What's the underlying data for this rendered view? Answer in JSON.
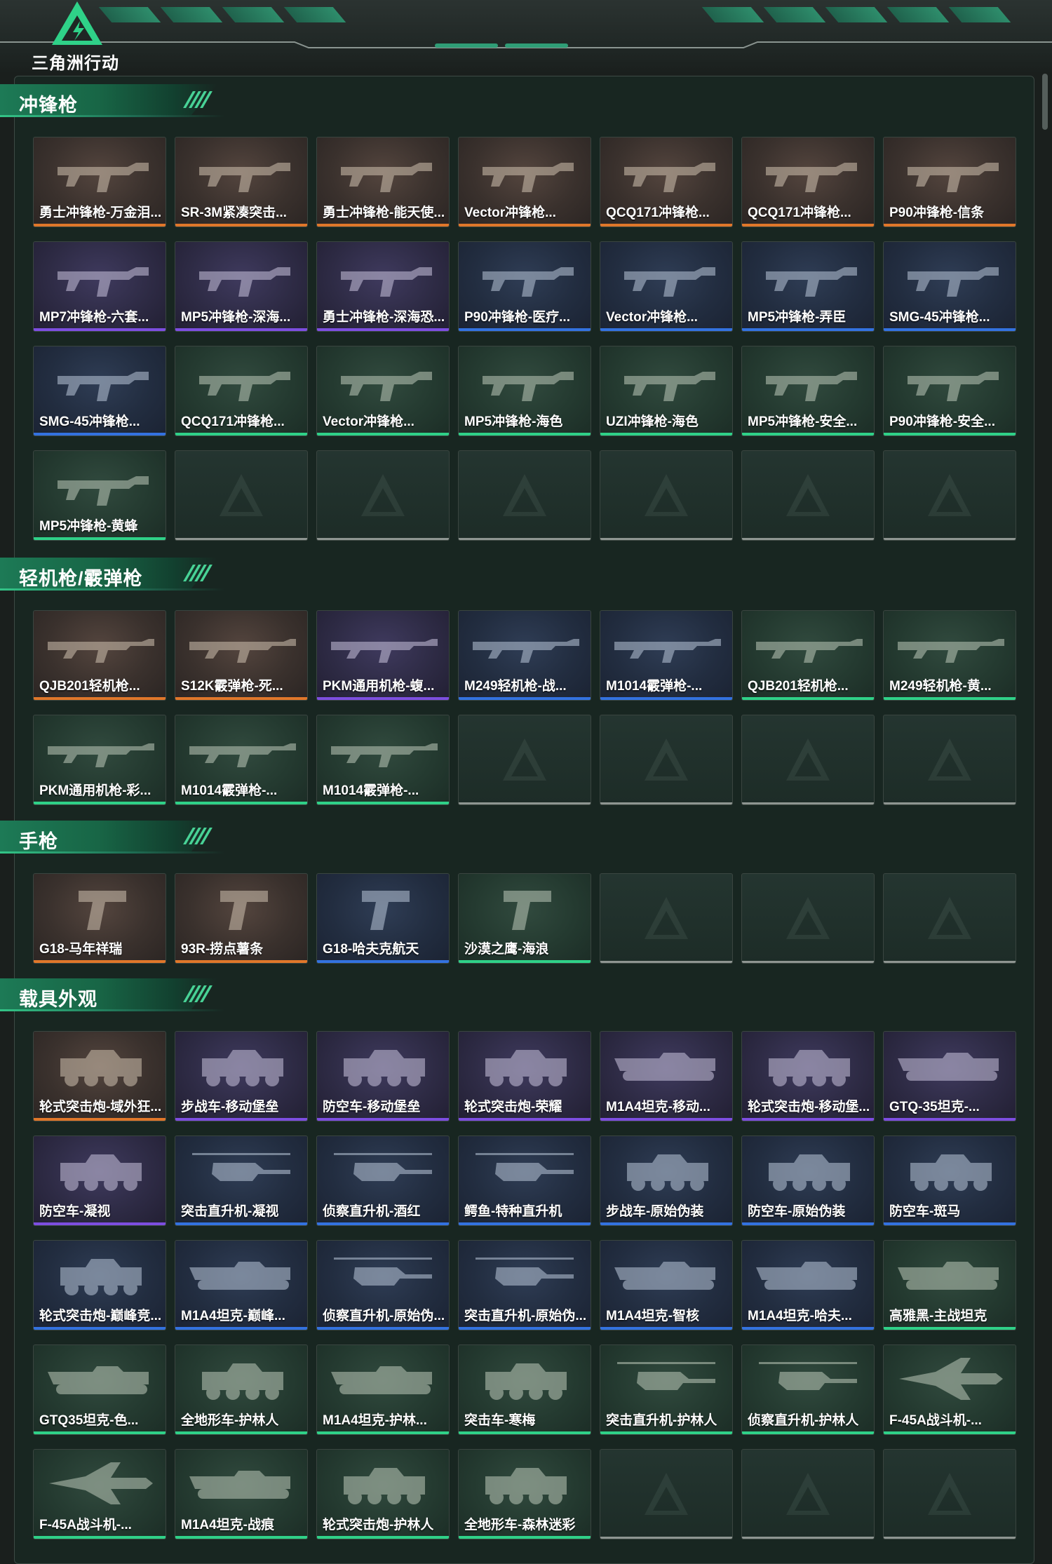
{
  "app": {
    "logo_text": "三角洲行动"
  },
  "colors": {
    "orange": "#e0772a",
    "purple": "#7d4ee0",
    "blue": "#3372e0",
    "green": "#2fd188",
    "accent": "#2f9d76"
  },
  "sections": [
    {
      "title": "冲锋枪",
      "items": [
        {
          "name": "勇士冲锋枪-万金泪...",
          "rarity": "orange",
          "art": "smg"
        },
        {
          "name": "SR-3M紧凑突击...",
          "rarity": "orange",
          "art": "smg"
        },
        {
          "name": "勇士冲锋枪-能天使...",
          "rarity": "orange",
          "art": "smg"
        },
        {
          "name": "Vector冲锋枪...",
          "rarity": "orange",
          "art": "smg"
        },
        {
          "name": "QCQ171冲锋枪...",
          "rarity": "orange",
          "art": "smg"
        },
        {
          "name": "QCQ171冲锋枪...",
          "rarity": "orange",
          "art": "smg"
        },
        {
          "name": "P90冲锋枪-信条",
          "rarity": "orange",
          "art": "smg"
        },
        {
          "name": "MP7冲锋枪-六套...",
          "rarity": "purple",
          "art": "smg"
        },
        {
          "name": "MP5冲锋枪-深海...",
          "rarity": "purple",
          "art": "smg"
        },
        {
          "name": "勇士冲锋枪-深海恐...",
          "rarity": "purple",
          "art": "smg"
        },
        {
          "name": "P90冲锋枪-医疗...",
          "rarity": "blue",
          "art": "smg"
        },
        {
          "name": "Vector冲锋枪...",
          "rarity": "blue",
          "art": "smg"
        },
        {
          "name": "MP5冲锋枪-弄臣",
          "rarity": "blue",
          "art": "smg"
        },
        {
          "name": "SMG-45冲锋枪...",
          "rarity": "blue",
          "art": "smg"
        },
        {
          "name": "SMG-45冲锋枪...",
          "rarity": "blue",
          "art": "smg"
        },
        {
          "name": "QCQ171冲锋枪...",
          "rarity": "green",
          "art": "smg"
        },
        {
          "name": "Vector冲锋枪...",
          "rarity": "green",
          "art": "smg"
        },
        {
          "name": "MP5冲锋枪-海色",
          "rarity": "green",
          "art": "smg"
        },
        {
          "name": "UZI冲锋枪-海色",
          "rarity": "green",
          "art": "smg"
        },
        {
          "name": "MP5冲锋枪-安全...",
          "rarity": "green",
          "art": "smg"
        },
        {
          "name": "P90冲锋枪-安全...",
          "rarity": "green",
          "art": "smg"
        },
        {
          "name": "MP5冲锋枪-黄蜂",
          "rarity": "green",
          "art": "smg"
        }
      ]
    },
    {
      "title": "轻机枪/霰弹枪",
      "items": [
        {
          "name": "QJB201轻机枪...",
          "rarity": "orange",
          "art": "lmg"
        },
        {
          "name": "S12K霰弹枪-死...",
          "rarity": "orange",
          "art": "lmg"
        },
        {
          "name": "PKM通用机枪-蝮...",
          "rarity": "purple",
          "art": "lmg"
        },
        {
          "name": "M249轻机枪-战...",
          "rarity": "blue",
          "art": "lmg"
        },
        {
          "name": "M1014霰弹枪-...",
          "rarity": "blue",
          "art": "lmg"
        },
        {
          "name": "QJB201轻机枪...",
          "rarity": "green",
          "art": "lmg"
        },
        {
          "name": "M249轻机枪-黄...",
          "rarity": "green",
          "art": "lmg"
        },
        {
          "name": "PKM通用机枪-彩...",
          "rarity": "green",
          "art": "lmg"
        },
        {
          "name": "M1014霰弹枪-...",
          "rarity": "green",
          "art": "lmg"
        },
        {
          "name": "M1014霰弹枪-...",
          "rarity": "green",
          "art": "lmg"
        }
      ]
    },
    {
      "title": "手枪",
      "items": [
        {
          "name": "G18-马年祥瑞",
          "rarity": "orange",
          "art": "pistol"
        },
        {
          "name": "93R-捞点薯条",
          "rarity": "orange",
          "art": "pistol"
        },
        {
          "name": "G18-哈夫克航天",
          "rarity": "blue",
          "art": "pistol"
        },
        {
          "name": "沙漠之鹰-海浪",
          "rarity": "green",
          "art": "pistol"
        }
      ]
    },
    {
      "title": "载具外观",
      "items": [
        {
          "name": "轮式突击炮-域外狂...",
          "rarity": "orange",
          "art": "vehicle"
        },
        {
          "name": "步战车-移动堡垒",
          "rarity": "purple",
          "art": "vehicle"
        },
        {
          "name": "防空车-移动堡垒",
          "rarity": "purple",
          "art": "vehicle"
        },
        {
          "name": "轮式突击炮-荣耀",
          "rarity": "purple",
          "art": "vehicle"
        },
        {
          "name": "M1A4坦克-移动...",
          "rarity": "purple",
          "art": "tank"
        },
        {
          "name": "轮式突击炮-移动堡...",
          "rarity": "purple",
          "art": "vehicle"
        },
        {
          "name": "GTQ-35坦克-...",
          "rarity": "purple",
          "art": "tank"
        },
        {
          "name": "防空车-凝视",
          "rarity": "purple",
          "art": "vehicle"
        },
        {
          "name": "突击直升机-凝视",
          "rarity": "blue",
          "art": "heli"
        },
        {
          "name": "侦察直升机-酒红",
          "rarity": "blue",
          "art": "heli"
        },
        {
          "name": "鳄鱼-特种直升机",
          "rarity": "blue",
          "art": "heli"
        },
        {
          "name": "步战车-原始伪装",
          "rarity": "blue",
          "art": "vehicle"
        },
        {
          "name": "防空车-原始伪装",
          "rarity": "blue",
          "art": "vehicle"
        },
        {
          "name": "防空车-斑马",
          "rarity": "blue",
          "art": "vehicle"
        },
        {
          "name": "轮式突击炮-巅峰竞...",
          "rarity": "blue",
          "art": "vehicle"
        },
        {
          "name": "M1A4坦克-巅峰...",
          "rarity": "blue",
          "art": "tank"
        },
        {
          "name": "侦察直升机-原始伪...",
          "rarity": "blue",
          "art": "heli"
        },
        {
          "name": "突击直升机-原始伪...",
          "rarity": "blue",
          "art": "heli"
        },
        {
          "name": "M1A4坦克-智核",
          "rarity": "blue",
          "art": "tank"
        },
        {
          "name": "M1A4坦克-哈夫...",
          "rarity": "blue",
          "art": "tank"
        },
        {
          "name": "高雅黑-主战坦克",
          "rarity": "green",
          "art": "tank"
        },
        {
          "name": "GTQ35坦克-色...",
          "rarity": "green",
          "art": "tank"
        },
        {
          "name": "全地形车-护林人",
          "rarity": "green",
          "art": "vehicle"
        },
        {
          "name": "M1A4坦克-护林...",
          "rarity": "green",
          "art": "tank"
        },
        {
          "name": "突击车-寒梅",
          "rarity": "green",
          "art": "vehicle"
        },
        {
          "name": "突击直升机-护林人",
          "rarity": "green",
          "art": "heli"
        },
        {
          "name": "侦察直升机-护林人",
          "rarity": "green",
          "art": "heli"
        },
        {
          "name": "F-45A战斗机-...",
          "rarity": "green",
          "art": "jet"
        },
        {
          "name": "F-45A战斗机-...",
          "rarity": "green",
          "art": "jet"
        },
        {
          "name": "M1A4坦克-战痕",
          "rarity": "green",
          "art": "tank"
        },
        {
          "name": "轮式突击炮-护林人",
          "rarity": "green",
          "art": "vehicle"
        },
        {
          "name": "全地形车-森林迷彩",
          "rarity": "green",
          "art": "vehicle"
        }
      ]
    }
  ]
}
